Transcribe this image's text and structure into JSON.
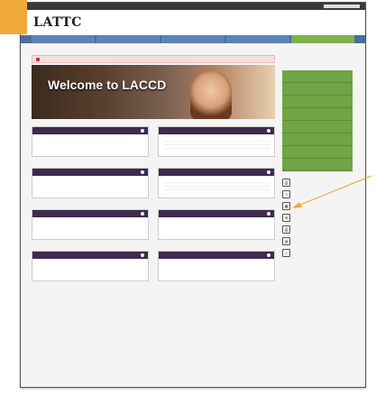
{
  "logo": "LATTC",
  "top_links": [
    "",
    "",
    "",
    ""
  ],
  "nav": [
    "",
    "",
    "",
    "",
    ""
  ],
  "breadcrumb": "",
  "alert": "",
  "subtext": "",
  "banner_title": "Welcome to LACCD",
  "widgets_left": [
    {
      "title": "",
      "message": "",
      "link": ""
    },
    {
      "title": "",
      "message": "",
      "link": ""
    },
    {
      "title": "",
      "message": "",
      "link": ""
    },
    {
      "title": "",
      "message": "",
      "link": ""
    }
  ],
  "widgets_right": [
    {
      "title": "",
      "message": "",
      "rows": [
        [
          "",
          ""
        ],
        [
          "",
          ""
        ],
        [
          "",
          ""
        ]
      ]
    },
    {
      "title": "",
      "message": "",
      "rows": [
        [
          "",
          ""
        ],
        [
          "",
          ""
        ],
        [
          "",
          ""
        ]
      ]
    },
    {
      "title": "",
      "message": "",
      "rows": []
    },
    {
      "title": "",
      "message": "",
      "rows": []
    }
  ],
  "sidebar_buttons": [
    "",
    "",
    "",
    "",
    "",
    "",
    "",
    ""
  ],
  "quick_links": [
    {
      "label": "",
      "icon": "printer-icon"
    },
    {
      "label": "",
      "icon": "help-icon"
    },
    {
      "label": "",
      "icon": "calendar-icon"
    },
    {
      "label": "",
      "icon": "mail-icon"
    },
    {
      "label": "",
      "icon": "printer-icon"
    },
    {
      "label": "",
      "icon": "document-icon"
    },
    {
      "label": "",
      "icon": "info-icon"
    }
  ],
  "colors": {
    "accent_orange": "#f2a93b",
    "nav_blue": "#4a6f9c",
    "sidebar_green": "#6fa544",
    "widget_purple": "#3e2b4f"
  }
}
